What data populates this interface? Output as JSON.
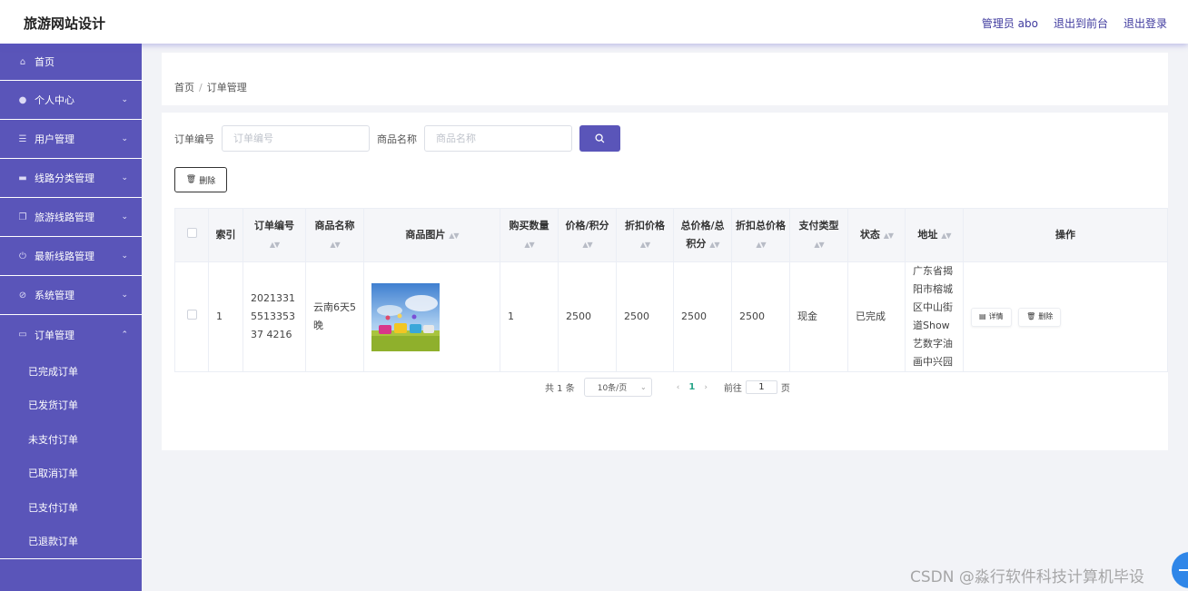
{
  "header": {
    "title": "旅游网站设计",
    "admin": "管理员 abo",
    "to_front": "退出到前台",
    "logout": "退出登录"
  },
  "sidebar": {
    "items": [
      {
        "label": "首页",
        "icon": "home-icon"
      },
      {
        "label": "个人中心",
        "icon": "person-icon"
      },
      {
        "label": "用户管理",
        "icon": "sliders-icon"
      },
      {
        "label": "线路分类管理",
        "icon": "ticket-icon"
      },
      {
        "label": "旅游线路管理",
        "icon": "copy-icon"
      },
      {
        "label": "最新线路管理",
        "icon": "power-icon"
      },
      {
        "label": "系统管理",
        "icon": "settings-icon"
      },
      {
        "label": "订单管理",
        "icon": "monitor-icon"
      }
    ],
    "sub_items": [
      "已完成订单",
      "已发货订单",
      "未支付订单",
      "已取消订单",
      "已支付订单",
      "已退款订单"
    ]
  },
  "breadcrumb": {
    "home": "首页",
    "current": "订单管理"
  },
  "search": {
    "order_label": "订单编号",
    "order_placeholder": "订单编号",
    "goods_label": "商品名称",
    "goods_placeholder": "商品名称"
  },
  "toolbar": {
    "delete_label": "删除"
  },
  "table": {
    "columns": [
      "索引",
      "订单编号",
      "商品名称",
      "商品图片",
      "购买数量",
      "价格/积分",
      "折扣价格",
      "总价格/总积分",
      "折扣总价格",
      "支付类型",
      "状态",
      "地址",
      "操作"
    ],
    "rows": [
      {
        "index": "1",
        "order_no": "2021331551335337 4216",
        "goods_name": "云南6天5晚",
        "qty": "1",
        "price": "2500",
        "discount_price": "2500",
        "total_price": "2500",
        "discount_total": "2500",
        "pay_type": "现金",
        "status": "已完成",
        "address": "广东省揭阳市榕城区中山街道Show艺数字油画中兴园",
        "detail_label": "详情",
        "delete_label": "删除"
      }
    ]
  },
  "pagination": {
    "total": "共 1 条",
    "page_size": "10条/页",
    "current_page": "1",
    "goto_label": "前往",
    "goto_value": "1",
    "page_suffix": "页"
  },
  "watermark": "CSDN @淼行软件科技计算机毕设",
  "colors": {
    "brand": "#5a55b9",
    "accent_page": "#2aa68a"
  }
}
